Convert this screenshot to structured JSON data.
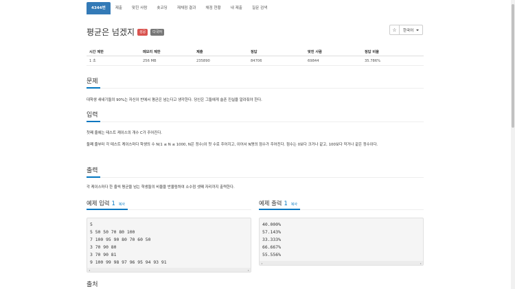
{
  "tabs": [
    {
      "label": "4344번",
      "active": true
    },
    {
      "label": "제출",
      "active": false
    },
    {
      "label": "맞힌 사람",
      "active": false
    },
    {
      "label": "숏코딩",
      "active": false
    },
    {
      "label": "재채점 결과",
      "active": false
    },
    {
      "label": "채점 현황",
      "active": false
    },
    {
      "label": "내 제출",
      "active": false
    },
    {
      "label": "질문 검색",
      "active": false
    }
  ],
  "problem": {
    "title": "평균은 넘겠지",
    "badges": {
      "success": "성공",
      "multilang": "다국어"
    }
  },
  "language": {
    "star_icon": "star-icon",
    "label": "한국어"
  },
  "info_table": {
    "headers": [
      "시간 제한",
      "메모리 제한",
      "제출",
      "정답",
      "맞힌 사람",
      "정답 비율"
    ],
    "values": [
      "1 초",
      "256 MB",
      "235890",
      "84706",
      "69844",
      "35.786%"
    ]
  },
  "sections": {
    "problem_title": "문제",
    "problem_text": "대학생 새내기들의 90%는 자신이 반에서 평균은 넘는다고 생각한다. 당신은 그들에게 슬픈 진실을 알려줘야 한다.",
    "input_title": "입력",
    "input_text_1": "첫째 줄에는 테스트 케이스의 개수 C가 주어진다.",
    "input_text_2": "둘째 줄부터 각 테스트 케이스마다 학생의 수 N(1 ≤ N ≤ 1000, N은 정수)이 첫 수로 주어지고, 이어서 N명의 점수가 주어진다. 점수는 0보다 크거나 같고, 100보다 작거나 같은 정수이다.",
    "output_title": "출력",
    "output_text": "각 케이스마다 한 줄씩 평균을 넘는 학생들의 비율을 반올림하여 소수점 셋째 자리까지 출력한다.",
    "source_title": "출처"
  },
  "sample_input": {
    "label": "예제 입력",
    "number": "1",
    "copy": "복사",
    "lines": [
      "5",
      "5 50 50 70 80 100",
      "7 100 95 90 80 70 60 50",
      "3 70 90 80",
      "3 70 90 81",
      "9 100 99 98 97 96 95 94 93 91"
    ]
  },
  "sample_output": {
    "label": "예제 출력",
    "number": "1",
    "copy": "복사",
    "lines": [
      "40.000%",
      "57.143%",
      "33.333%",
      "66.667%",
      "55.556%"
    ]
  },
  "colors": {
    "accent": "#337ab7",
    "link": "#0076c0",
    "success": "#d9534f",
    "multilang": "#777777"
  }
}
